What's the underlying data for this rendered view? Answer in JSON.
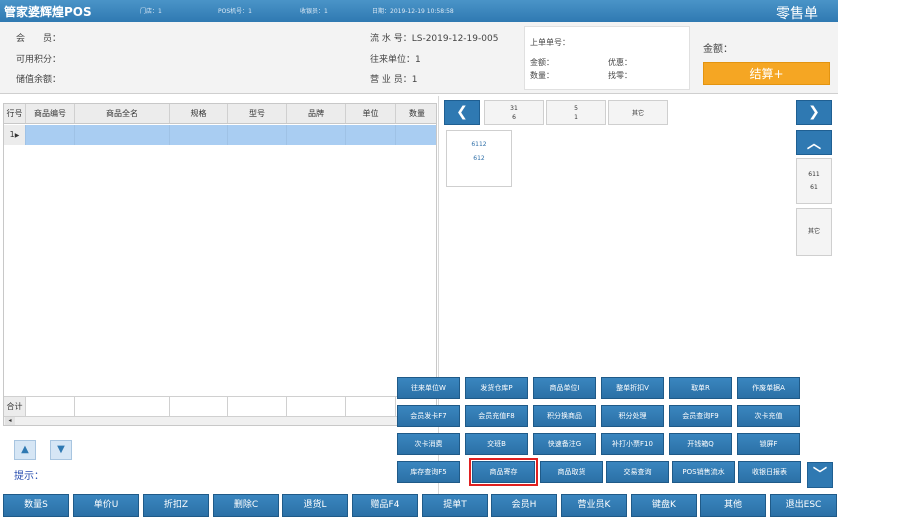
{
  "titlebar": {
    "app_name": "管家婆辉煌POS",
    "store": "门店：1",
    "pos_no": "POS机号：1",
    "cashier": "收银员：1",
    "date": "日期：2019-12-19 10:58:58",
    "mode": "零售单"
  },
  "info": {
    "member": "会　　员：",
    "points": "可用积分：",
    "balance": "储值余额：",
    "serial": "流 水 号：LS-2019-12-19-005",
    "unit": "往来单位：1",
    "salesman": "营 业 员：1",
    "prev_bill": "上单单号：",
    "amount": "金额：",
    "discount": "优惠：",
    "qty": "数量：",
    "change": "找零：",
    "total_amount": "金额：",
    "checkout": "结算+"
  },
  "grid": {
    "columns": [
      "行号",
      "商品编号",
      "商品全名",
      "规格",
      "型号",
      "品牌",
      "单位",
      "数量"
    ],
    "row_number": "1",
    "row_marker": "▶",
    "total_label": "合计"
  },
  "categories": {
    "prev": "❮",
    "tabs": [
      {
        "line1": "31",
        "line2": "6"
      },
      {
        "line1": "5",
        "line2": "1"
      },
      {
        "line1": "其它",
        "line2": ""
      }
    ],
    "product": {
      "line1": "6112",
      "line2": "612"
    },
    "next": "❯",
    "up": "︿",
    "down": "﹀",
    "side_tabs": [
      {
        "line1": "611",
        "line2": "61"
      },
      {
        "line1": "其它",
        "line2": ""
      }
    ]
  },
  "functions": [
    [
      "往来单位W",
      "发货仓库P",
      "商品单位I",
      "整单折扣V",
      "取单R",
      "作废单据A"
    ],
    [
      "会员发卡F7",
      "会员充值F8",
      "积分换商品",
      "积分处理",
      "会员查询F9",
      "次卡充值"
    ],
    [
      "次卡消费",
      "交班B",
      "快速备注G",
      "补打小票F10",
      "开钱箱Q",
      "锁屏F"
    ],
    [
      "库存查询F5",
      "商品寄存",
      "商品取货",
      "交易查询",
      "POS销售流水",
      "收银日报表"
    ]
  ],
  "selected_function": "商品寄存",
  "scroll_up": "▲",
  "scroll_down": "▼",
  "hint": "提示：",
  "bottom": [
    "数量S",
    "单价U",
    "折扣Z",
    "删除C",
    "退货L",
    "赠品F4",
    "提单T",
    "会员H",
    "营业员K",
    "键盘K",
    "其他",
    "退出ESC"
  ]
}
